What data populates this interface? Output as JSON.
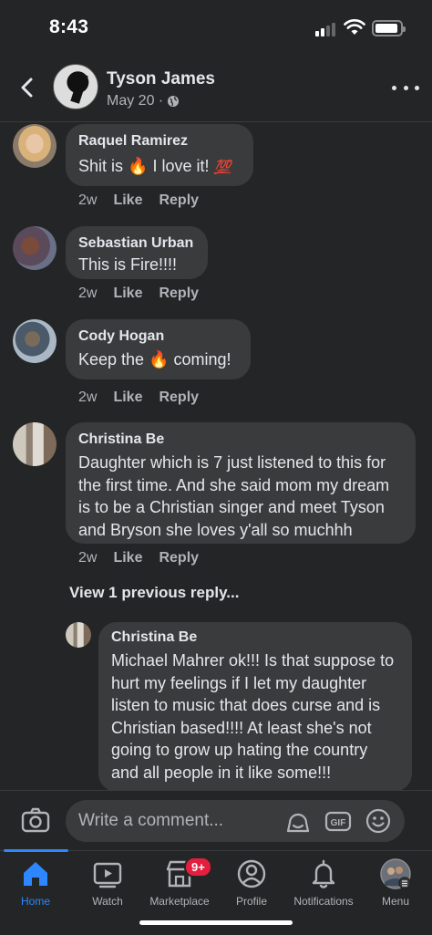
{
  "status_bar": {
    "time": "8:43"
  },
  "header": {
    "name": "Tyson James",
    "date": "May 20 ·"
  },
  "comments": [
    {
      "author": "Raquel Ramirez",
      "text_before": "Shit is ",
      "text_mid": " I love it! ",
      "hundred": "💯",
      "time": "2w",
      "like": "Like",
      "reply": "Reply"
    },
    {
      "author": "Sebastian Urban",
      "text": "This is Fire!!!!",
      "time": "2w",
      "like": "Like",
      "reply": "Reply"
    },
    {
      "author": "Cody Hogan",
      "text_before": "Keep the ",
      "text_after": " coming!",
      "time": "2w",
      "like": "Like",
      "reply": "Reply"
    },
    {
      "author": "Christina Be",
      "text": "Daughter which is 7 just listened to this for the first time. And she said mom my dream is to be a Christian singer and meet Tyson and Bryson she loves y'all so muchhh",
      "time": "2w",
      "like": "Like",
      "reply": "Reply"
    }
  ],
  "view_replies": "View 1 previous reply...",
  "reply": {
    "author": "Christina Be",
    "text": "Michael Mahrer ok!!! Is that suppose to hurt my feelings if I let my daughter listen to music that does curse and is Christian based!!!! At least she's not going to grow up hating the country and all people in it like some!!!"
  },
  "composer": {
    "placeholder": "Write a comment...",
    "gif_label": "GIF"
  },
  "tabs": [
    {
      "label": "Home"
    },
    {
      "label": "Watch"
    },
    {
      "label": "Marketplace",
      "badge": "9+"
    },
    {
      "label": "Profile"
    },
    {
      "label": "Notifications"
    },
    {
      "label": "Menu"
    }
  ],
  "colors": {
    "accent": "#2d88ff",
    "bubble": "#3a3b3c",
    "background": "#242526",
    "badge": "#e41e3f"
  }
}
